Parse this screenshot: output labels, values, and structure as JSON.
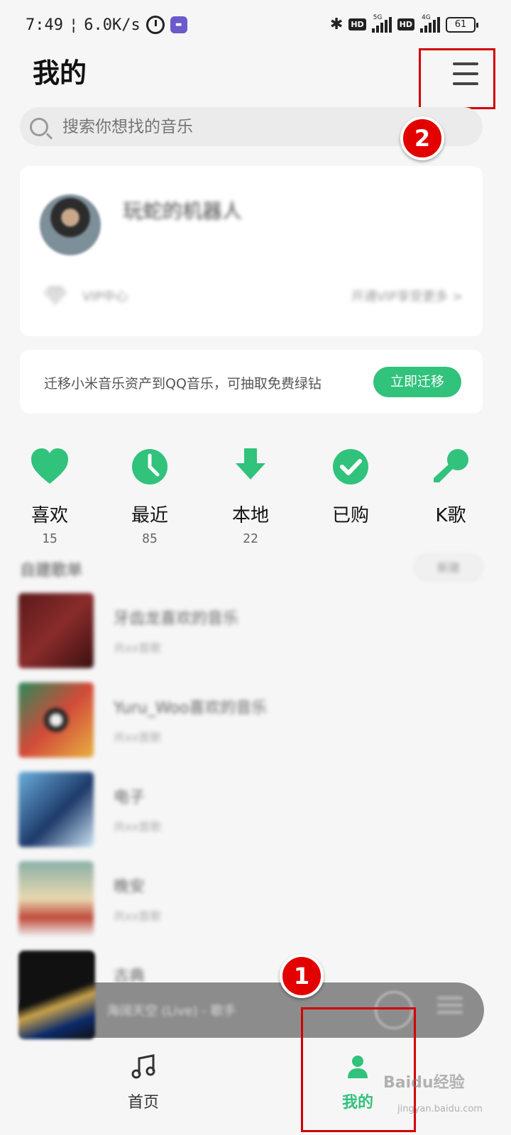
{
  "status_bar": {
    "time": "7:49",
    "speed": "6.0K/s",
    "battery": "61",
    "network_1": "5G",
    "network_2": "4G",
    "hd": "HD"
  },
  "header": {
    "title": "我的"
  },
  "search": {
    "placeholder": "搜索你想找的音乐"
  },
  "annotations": {
    "marker_1": "1",
    "marker_2": "2"
  },
  "profile": {
    "username": "玩蛇的机器人",
    "vip_label": "VIP中心",
    "vip_right": "开通VIP享受更多 >"
  },
  "migrate": {
    "text": "迁移小米音乐资产到QQ音乐，可抽取免费绿钻",
    "button": "立即迁移"
  },
  "quick": [
    {
      "label": "喜欢",
      "count": "15",
      "icon": "heart-icon"
    },
    {
      "label": "最近",
      "count": "85",
      "icon": "clock-icon"
    },
    {
      "label": "本地",
      "count": "22",
      "icon": "download-icon"
    },
    {
      "label": "已购",
      "count": "",
      "icon": "check-icon"
    },
    {
      "label": "K歌",
      "count": "",
      "icon": "microphone-icon"
    }
  ],
  "playlists": {
    "section_title": "自建歌单",
    "new_label": "新建",
    "items": [
      {
        "name": "牙齿龙喜欢的音乐",
        "count": "共xx首歌"
      },
      {
        "name": "Yuru_Woo喜欢的音乐",
        "count": "共xx首歌"
      },
      {
        "name": "电子",
        "count": "共xx首歌"
      },
      {
        "name": "晚安",
        "count": "共xx首歌"
      },
      {
        "name": "古典",
        "count": ""
      }
    ]
  },
  "mini_player": {
    "title": "海阔天空 (Live) - 歌手"
  },
  "bottom_nav": {
    "home": "首页",
    "mine": "我的"
  },
  "watermark": {
    "main": "Baidu经验",
    "sub": "jingyan.baidu.com"
  },
  "colors": {
    "accent": "#31c27c",
    "annotation_red": "#d20000"
  }
}
